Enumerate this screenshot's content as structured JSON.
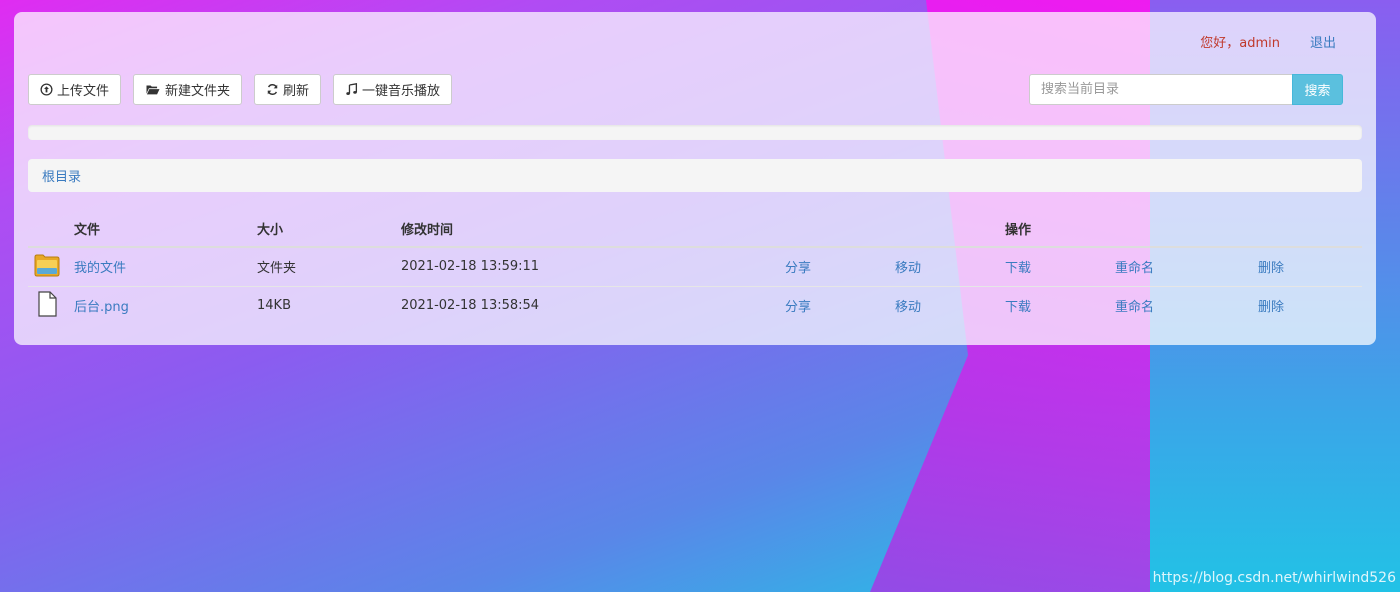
{
  "header": {
    "greeting": "您好，admin",
    "logout_label": "退出"
  },
  "toolbar": {
    "upload_label": "上传文件",
    "new_folder_label": "新建文件夹",
    "refresh_label": "刷新",
    "music_label": "一键音乐播放"
  },
  "search": {
    "placeholder": "搜索当前目录",
    "value": "",
    "button_label": "搜索"
  },
  "progress": {
    "percent": 0
  },
  "breadcrumb": {
    "root_label": "根目录"
  },
  "table": {
    "headers": {
      "file": "文件",
      "size": "大小",
      "modified": "修改时间",
      "actions": "操作"
    },
    "rows": [
      {
        "icon": "folder-icon",
        "name": "我的文件",
        "size": "文件夹",
        "modified": "2021-02-18 13:59:11",
        "share": "分享",
        "move": "移动",
        "download": "下载",
        "rename": "重命名",
        "delete": "删除"
      },
      {
        "icon": "file-icon",
        "name": "后台.png",
        "size": "14KB",
        "modified": "2021-02-18 13:58:54",
        "share": "分享",
        "move": "移动",
        "download": "下载",
        "rename": "重命名",
        "delete": "删除"
      }
    ]
  },
  "watermark": "https://blog.csdn.net/whirlwind526",
  "colors": {
    "accent": "#5bc0de",
    "link": "#3a7bc0",
    "greeting": "#c0392b"
  }
}
